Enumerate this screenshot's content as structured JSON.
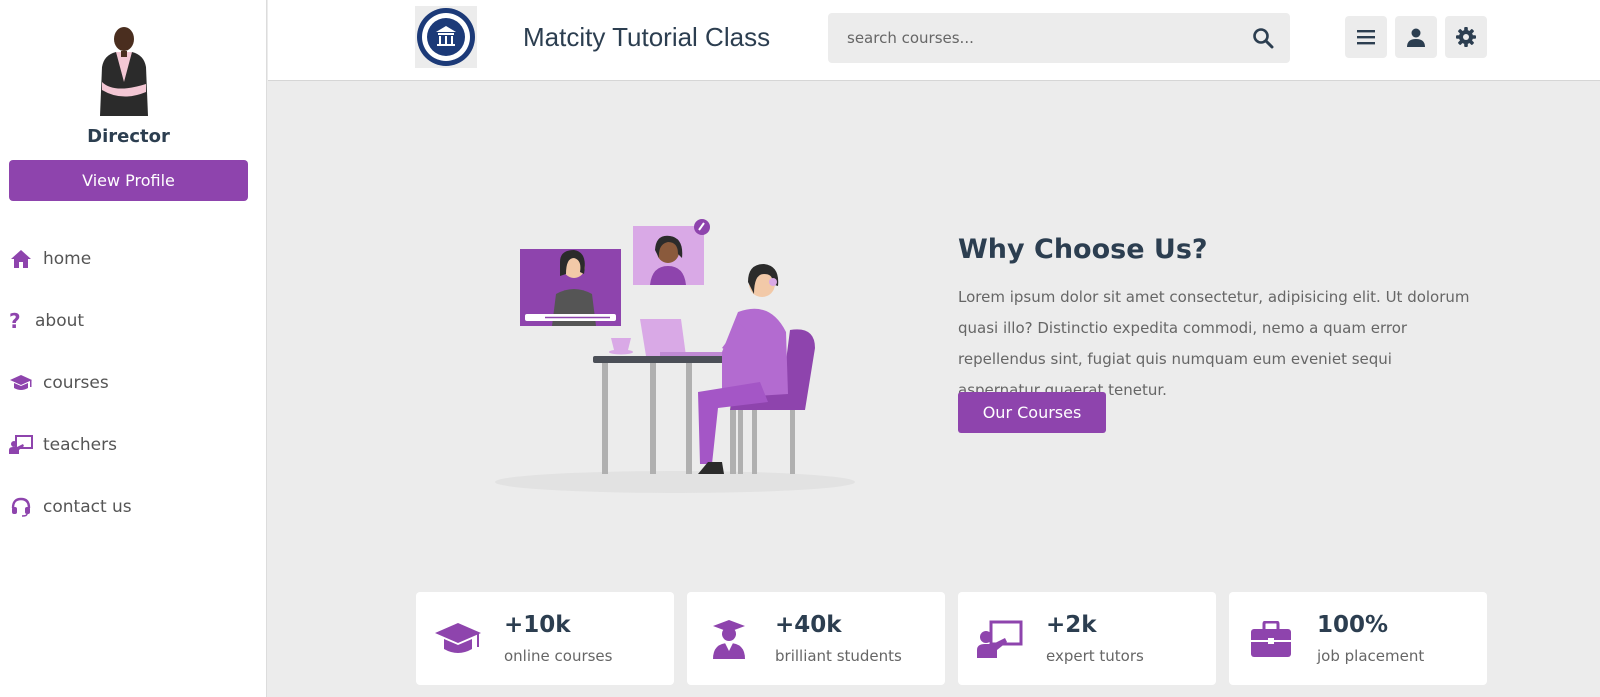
{
  "sidebar": {
    "role": "Director",
    "view_profile_label": "View Profile",
    "items": [
      {
        "label": "home",
        "icon": "home-icon"
      },
      {
        "label": "about",
        "icon": "question-icon"
      },
      {
        "label": "courses",
        "icon": "graduation-cap-icon"
      },
      {
        "label": "teachers",
        "icon": "chalkboard-teacher-icon"
      },
      {
        "label": "contact us",
        "icon": "headset-icon"
      }
    ]
  },
  "header": {
    "title": "Matcity Tutorial Class",
    "search_placeholder": "search courses...",
    "buttons": [
      "menu-icon",
      "user-icon",
      "settings-icon"
    ]
  },
  "hero": {
    "title": "Why Choose Us?",
    "text": "Lorem ipsum dolor sit amet consectetur, adipisicing elit. Ut dolorum quasi illo? Distinctio expedita commodi, nemo a quam error repellendus sint, fugiat quis numquam eum eveniet sequi aspernatur quaerat tenetur.",
    "button_label": "Our Courses"
  },
  "stats": [
    {
      "value": "+10k",
      "label": "online courses",
      "icon": "graduation-cap-icon"
    },
    {
      "value": "+40k",
      "label": "brilliant students",
      "icon": "user-graduate-icon"
    },
    {
      "value": "+2k",
      "label": "expert tutors",
      "icon": "chalkboard-teacher-icon"
    },
    {
      "value": "100%",
      "label": "job placement",
      "icon": "briefcase-icon"
    }
  ],
  "colors": {
    "accent": "#8e44ad",
    "text_dark": "#2c3e50",
    "background": "#ececec"
  }
}
